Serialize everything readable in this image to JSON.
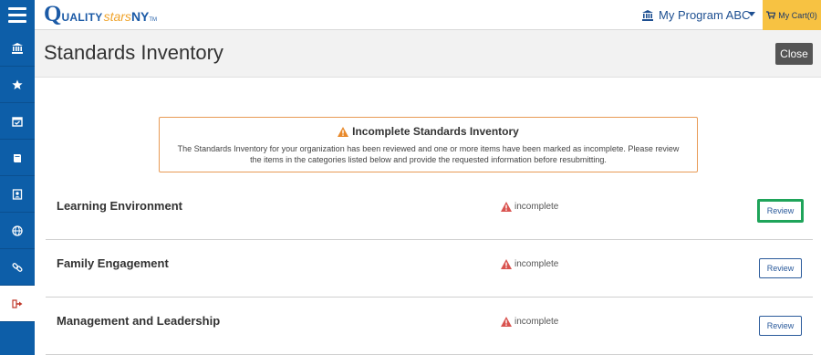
{
  "topbar": {
    "logo": {
      "q": "Q",
      "uality": "UALITY",
      "stars": "stars",
      "ny": "NY",
      "tm": "TM"
    },
    "program_label": "My Program ABC",
    "cart_label": "My Cart(0)"
  },
  "sidebar": {
    "items": [
      {
        "icon": "bank-icon"
      },
      {
        "icon": "star-icon"
      },
      {
        "icon": "calendar-check-icon"
      },
      {
        "icon": "book-icon"
      },
      {
        "icon": "id-badge-icon"
      },
      {
        "icon": "globe-icon"
      },
      {
        "icon": "link-icon"
      },
      {
        "icon": "sign-out-icon",
        "active": true
      }
    ]
  },
  "page": {
    "title": "Standards Inventory",
    "close_label": "Close"
  },
  "alert": {
    "title": "Incomplete Standards Inventory",
    "message": "The Standards Inventory for your organization has been reviewed and one or more items have been marked as incomplete. Please review the items in the categories listed below and provide the requested information before resubmitting."
  },
  "categories": [
    {
      "name": "Learning Environment",
      "status": "incomplete",
      "action": "Review"
    },
    {
      "name": "Family Engagement",
      "status": "incomplete",
      "action": "Review"
    },
    {
      "name": "Management and Leadership",
      "status": "incomplete",
      "action": "Review"
    }
  ],
  "colors": {
    "sidebar": "#0d5ea8",
    "cart": "#f7c242",
    "alert_border": "#e89a55",
    "status_warning": "#d9534f",
    "focus_ring": "#1fa45a"
  }
}
